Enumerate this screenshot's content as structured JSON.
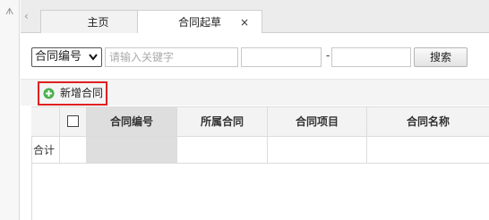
{
  "sidebar": {
    "pin_icon": "pin-icon"
  },
  "tabs": {
    "scroll_left_icon": "chevron-left-icon",
    "items": [
      {
        "label": "主页"
      },
      {
        "label": "合同起草",
        "close": "×"
      }
    ]
  },
  "search": {
    "field_selected": "合同编号",
    "keyword_placeholder": "请输入关键字",
    "range_separator": "-",
    "search_label": "搜索"
  },
  "toolbar": {
    "add_label": "新增合同"
  },
  "grid": {
    "columns": [
      "合同编号",
      "所属合同",
      "合同项目",
      "合同名称"
    ],
    "total_label": "合计"
  },
  "colors": {
    "highlight_border": "#e02020",
    "add_icon": "#4caf50"
  }
}
